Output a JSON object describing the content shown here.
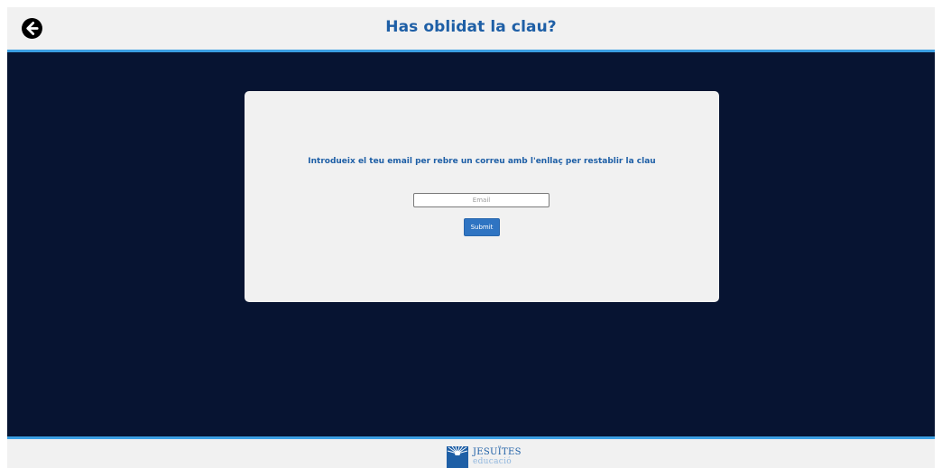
{
  "header": {
    "title": "Has oblidat la clau?",
    "back_icon": "arrow-left-circle-icon"
  },
  "form": {
    "instruction": "Introdueix el teu email per rebre un correu amb l'enllaç per restablir la clau",
    "email_placeholder": "Email",
    "submit_label": "Submit"
  },
  "footer": {
    "logo_name": "JESUÏTES",
    "logo_sub": "educació"
  },
  "colors": {
    "header_bg": "#f1f1f1",
    "accent_line": "#3b9fe3",
    "main_bg": "#071432",
    "title_blue": "#1e5fa6",
    "button_blue": "#2f74c2"
  }
}
